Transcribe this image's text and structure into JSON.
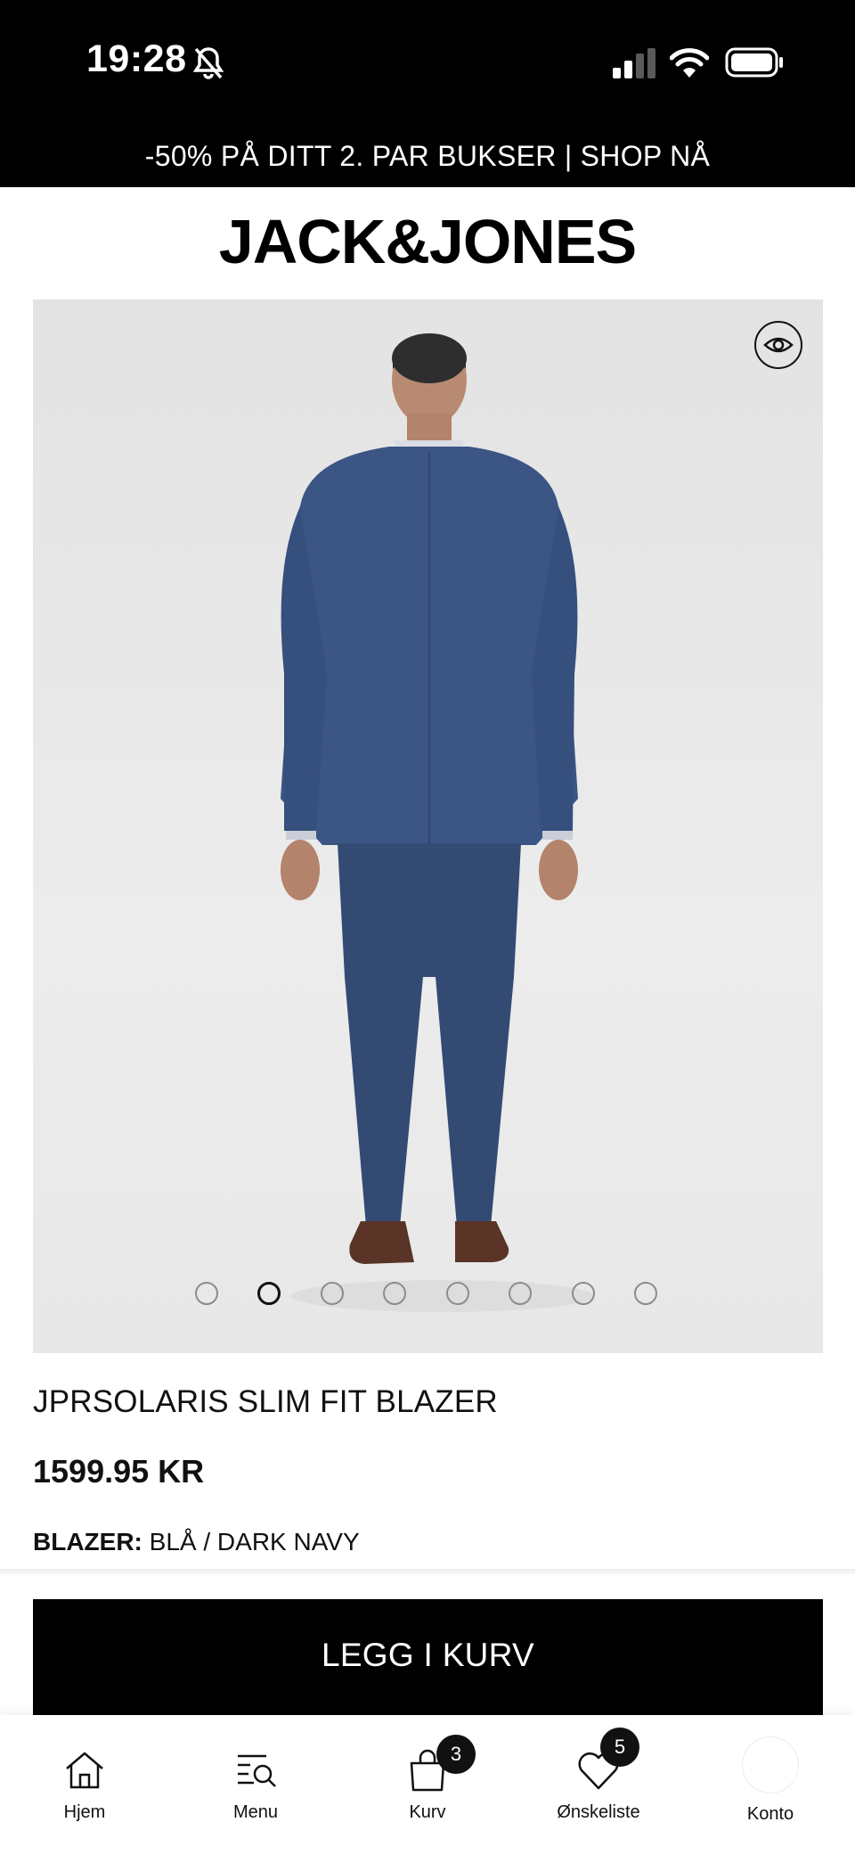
{
  "status_bar": {
    "time": "19:28"
  },
  "promo_banner": {
    "text": "-50% PÅ DITT 2. PAR BUKSER | SHOP NÅ"
  },
  "brand": {
    "logo_text": "JACK&JONES"
  },
  "gallery": {
    "slide_count": 8,
    "active_index": 1
  },
  "product": {
    "name": "JPRSOLARIS SLIM FIT BLAZER",
    "price": "1599.95 KR",
    "color_label": "BLAZER:",
    "color_value": "BLÅ / DARK NAVY"
  },
  "add_to_cart": {
    "label": "LEGG I KURV"
  },
  "bottom_nav": {
    "home": {
      "label": "Hjem",
      "icon": "home-icon"
    },
    "menu": {
      "label": "Menu",
      "icon": "menu-search-icon"
    },
    "cart": {
      "label": "Kurv",
      "icon": "bag-icon",
      "badge": "3"
    },
    "wishlist": {
      "label": "Ønskeliste",
      "icon": "heart-icon",
      "badge": "5"
    },
    "account": {
      "label": "Konto",
      "icon": "avatar"
    }
  }
}
